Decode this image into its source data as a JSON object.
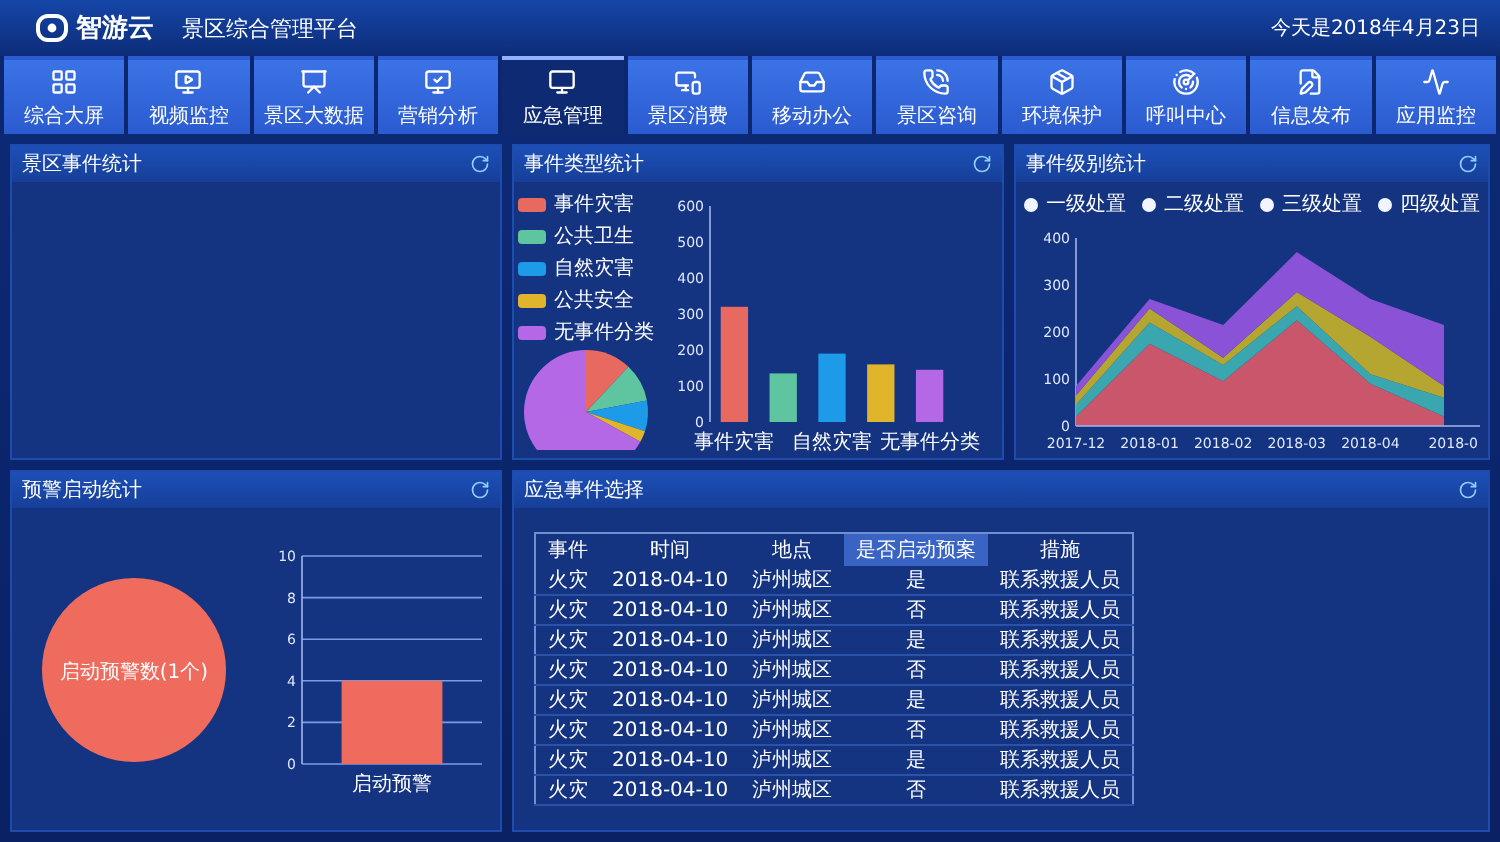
{
  "header": {
    "logo": "智游云",
    "title": "景区综合管理平台",
    "date": "今天是2018年4月23日"
  },
  "nav": [
    {
      "label": "综合大屏",
      "selected": false
    },
    {
      "label": "视频监控",
      "selected": false
    },
    {
      "label": "景区大数据",
      "selected": false
    },
    {
      "label": "营销分析",
      "selected": false
    },
    {
      "label": "应急管理",
      "selected": true
    },
    {
      "label": "景区消费",
      "selected": false
    },
    {
      "label": "移动办公",
      "selected": false
    },
    {
      "label": "景区咨询",
      "selected": false
    },
    {
      "label": "环境保护",
      "selected": false
    },
    {
      "label": "呼叫中心",
      "selected": false
    },
    {
      "label": "信息发布",
      "selected": false
    },
    {
      "label": "应用监控",
      "selected": false
    }
  ],
  "scenic_events": {
    "title": "景区事件统计"
  },
  "event_types": {
    "title": "事件类型统计",
    "legend": [
      {
        "label": "事件灾害",
        "color": "#e8695f"
      },
      {
        "label": "公共卫生",
        "color": "#5fc4a0"
      },
      {
        "label": "自然灾害",
        "color": "#1e9be8"
      },
      {
        "label": "公共安全",
        "color": "#e0b52c"
      },
      {
        "label": "无事件分类",
        "color": "#b468e6"
      }
    ],
    "pie": {
      "chart_data": {
        "type": "pie",
        "values": [
          12,
          10,
          8,
          3,
          67
        ]
      }
    },
    "bar": {
      "chart_data": {
        "type": "bar",
        "values": [
          320,
          135,
          190,
          160,
          145
        ],
        "ylim": [
          0,
          600
        ],
        "yticks": [
          0,
          100,
          200,
          300,
          400,
          500,
          600
        ],
        "categories": [
          "事件灾害",
          null,
          "自然灾害",
          null,
          "无事件分类"
        ]
      }
    }
  },
  "event_levels": {
    "title": "事件级别统计",
    "chart_data": {
      "type": "area",
      "stacked": true,
      "categories": [
        "2017-12",
        "2018-01",
        "2018-02",
        "2018-03",
        "2018-04",
        "2018-0"
      ],
      "ylim": [
        0,
        400
      ],
      "yticks": [
        0,
        100,
        200,
        300,
        400
      ],
      "series": [
        {
          "name": "一级处置",
          "color": "#c9566a",
          "values": [
            20,
            175,
            95,
            225,
            90,
            20
          ]
        },
        {
          "name": "二级处置",
          "color": "#3aa6b0",
          "values": [
            25,
            45,
            35,
            30,
            20,
            40
          ]
        },
        {
          "name": "三级处置",
          "color": "#b5a632",
          "values": [
            20,
            30,
            15,
            30,
            80,
            25
          ]
        },
        {
          "name": "四级处置",
          "color": "#8a52d6",
          "values": [
            20,
            20,
            70,
            85,
            80,
            130
          ]
        }
      ]
    }
  },
  "warnings": {
    "title": "预警启动统计",
    "pie": {
      "chart_data": {
        "type": "pie",
        "categories": [
          "启动预警数(1个)"
        ]
      }
    },
    "bar": {
      "chart_data": {
        "type": "bar",
        "categories": [
          "启动预警"
        ],
        "values": [
          4
        ],
        "ylim": [
          0,
          10
        ],
        "yticks": [
          0,
          2,
          4,
          6,
          8,
          10
        ],
        "grid": true
      }
    }
  },
  "emergency_events": {
    "title": "应急事件选择",
    "columns": [
      {
        "label": "事件",
        "selected": false
      },
      {
        "label": "时间",
        "selected": false
      },
      {
        "label": "地点",
        "selected": false
      },
      {
        "label": "是否启动预案",
        "selected": true
      },
      {
        "label": "措施",
        "selected": false
      }
    ],
    "rows": [
      [
        "火灾",
        "2018-04-10",
        "泸州城区",
        "是",
        "联系救援人员"
      ],
      [
        "火灾",
        "2018-04-10",
        "泸州城区",
        "否",
        "联系救援人员"
      ],
      [
        "火灾",
        "2018-04-10",
        "泸州城区",
        "是",
        "联系救援人员"
      ],
      [
        "火灾",
        "2018-04-10",
        "泸州城区",
        "否",
        "联系救援人员"
      ],
      [
        "火灾",
        "2018-04-10",
        "泸州城区",
        "是",
        "联系救援人员"
      ],
      [
        "火灾",
        "2018-04-10",
        "泸州城区",
        "否",
        "联系救援人员"
      ],
      [
        "火灾",
        "2018-04-10",
        "泸州城区",
        "是",
        "联系救援人员"
      ],
      [
        "火灾",
        "2018-04-10",
        "泸州城区",
        "否",
        "联系救援人员"
      ]
    ]
  }
}
